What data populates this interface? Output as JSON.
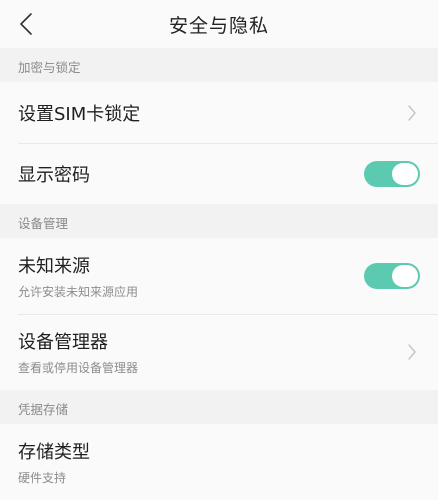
{
  "header": {
    "title": "安全与隐私"
  },
  "sections": [
    {
      "label": "加密与锁定",
      "items": [
        {
          "title": "设置SIM卡锁定"
        },
        {
          "title": "显示密码"
        }
      ]
    },
    {
      "label": "设备管理",
      "items": [
        {
          "title": "未知来源",
          "subtitle": "允许安装未知来源应用"
        },
        {
          "title": "设备管理器",
          "subtitle": "查看或停用设备管理器"
        }
      ]
    },
    {
      "label": "凭据存储",
      "items": [
        {
          "title": "存储类型",
          "subtitle": "硬件支持"
        }
      ]
    }
  ],
  "toggles": {
    "show_password": true,
    "unknown_sources": true
  },
  "colors": {
    "accent": "#5bcab1",
    "background": "#f2f2f2",
    "card": "#fafafa"
  },
  "icons": {
    "back": "chevron-left-icon",
    "forward": "chevron-right-icon"
  }
}
